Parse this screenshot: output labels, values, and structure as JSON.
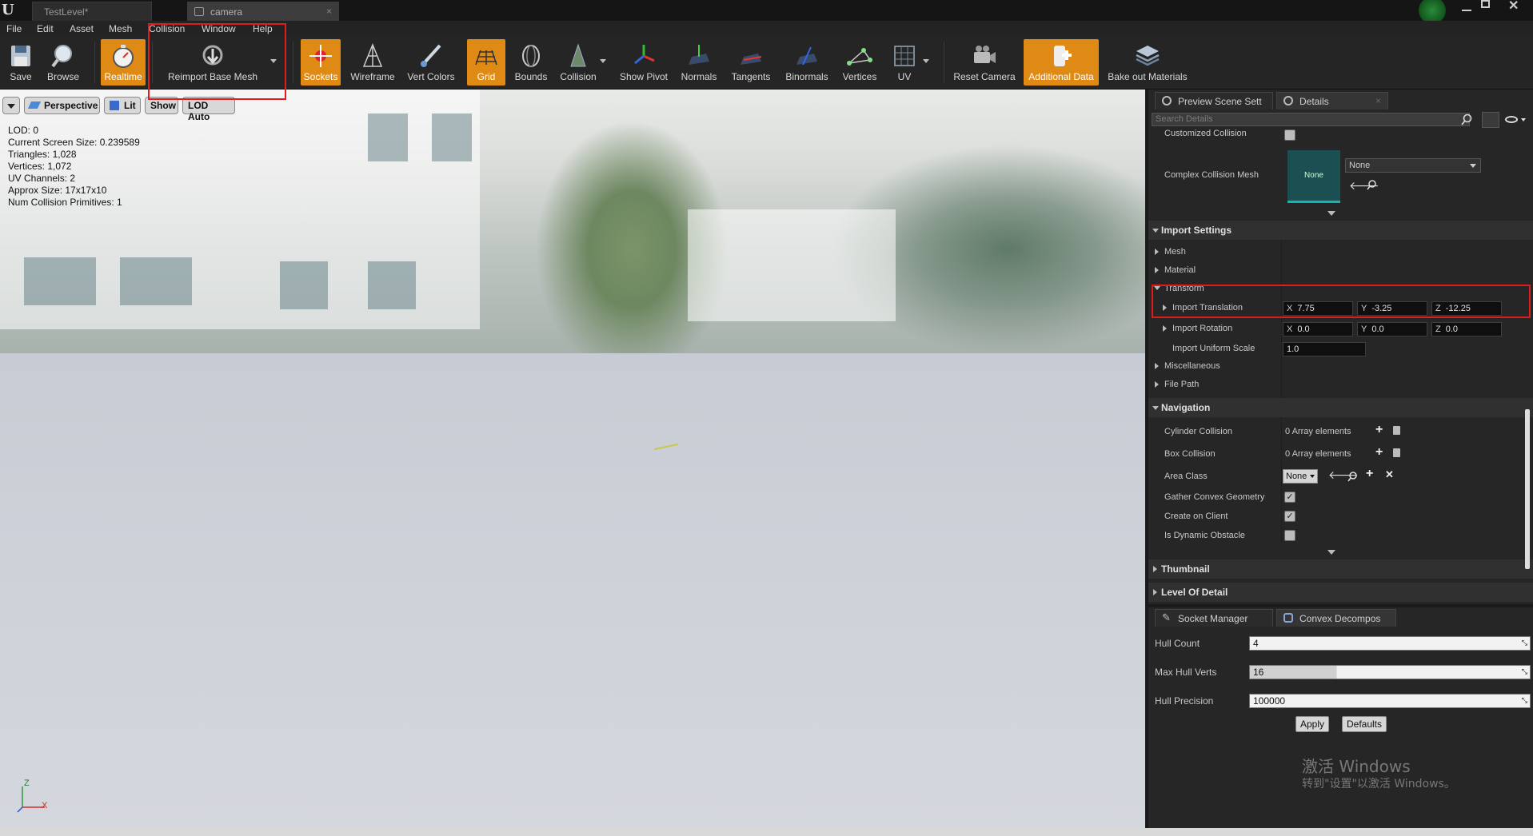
{
  "app": {
    "tabs": [
      {
        "label": "TestLevel*"
      },
      {
        "label": "camera"
      }
    ]
  },
  "menu": [
    "File",
    "Edit",
    "Asset",
    "Mesh",
    "Collision",
    "Window",
    "Help"
  ],
  "toolbar": {
    "save": "Save",
    "browse": "Browse",
    "realtime": "Realtime",
    "reimport": "Reimport Base Mesh",
    "sockets": "Sockets",
    "wireframe": "Wireframe",
    "vert_colors": "Vert Colors",
    "grid": "Grid",
    "bounds": "Bounds",
    "collision": "Collision",
    "show_pivot": "Show Pivot",
    "normals": "Normals",
    "tangents": "Tangents",
    "binormals": "Binormals",
    "vertices": "Vertices",
    "uv": "UV",
    "reset_camera": "Reset Camera",
    "additional_data": "Additional Data",
    "bake_out": "Bake out Materials"
  },
  "viewport": {
    "perspective": "Perspective",
    "lit": "Lit",
    "show": "Show",
    "lod": "LOD Auto",
    "stats": [
      "LOD:  0",
      "Current Screen Size:  0.239589",
      "Triangles:  1,028",
      "Vertices:  1,072",
      "UV Channels:  2",
      "Approx Size: 17x17x10",
      "Num Collision Primitives:  1"
    ],
    "axis_z": "Z",
    "axis_x": "X"
  },
  "details": {
    "tab_preview": "Preview Scene Sett",
    "tab_details": "Details",
    "search_placeholder": "Search Details",
    "customized_collision": "Customized Collision",
    "complex_collision_mesh": "Complex Collision Mesh",
    "thumb_none": "None",
    "mesh_select": "None",
    "import_settings": "Import Settings",
    "mesh": "Mesh",
    "material": "Material",
    "transform": "Transform",
    "import_translation": "Import Translation",
    "translation": {
      "x_label": "X",
      "x": "7.75",
      "y_label": "Y",
      "y": "-3.25",
      "z_label": "Z",
      "z": "-12.25"
    },
    "import_rotation": "Import Rotation",
    "rotation": {
      "x_label": "X",
      "x": "0.0",
      "y_label": "Y",
      "y": "0.0",
      "z_label": "Z",
      "z": "0.0"
    },
    "import_uniform_scale": "Import Uniform Scale",
    "scale": "1.0",
    "miscellaneous": "Miscellaneous",
    "file_path": "File Path",
    "navigation": "Navigation",
    "cylinder_collision": "Cylinder Collision",
    "cylinder_value": "0 Array elements",
    "box_collision": "Box Collision",
    "box_value": "0 Array elements",
    "area_class": "Area Class",
    "area_value": "None",
    "gather_convex": "Gather Convex Geometry",
    "create_on_client": "Create on Client",
    "is_dynamic": "Is Dynamic Obstacle",
    "thumbnail": "Thumbnail",
    "level_of_detail": "Level Of Detail"
  },
  "convex": {
    "tab_socket": "Socket Manager",
    "tab_convex": "Convex Decompos",
    "hull_count_label": "Hull Count",
    "hull_count": "4",
    "max_hull_verts_label": "Max Hull Verts",
    "max_hull_verts": "16",
    "hull_precision_label": "Hull Precision",
    "hull_precision": "100000",
    "apply": "Apply",
    "defaults": "Defaults"
  },
  "watermark": {
    "line1": "激活 Windows",
    "line2": "转到\"设置\"以激活 Windows。"
  },
  "colors": {
    "accent_orange": "#e08a16",
    "highlight_red": "#e01d1d",
    "panel_bg": "#262626"
  }
}
